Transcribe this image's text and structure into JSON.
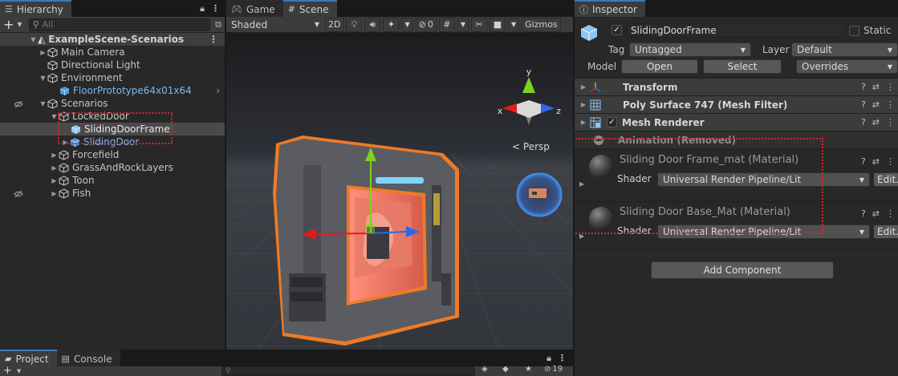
{
  "hierarchy": {
    "tab_label": "Hierarchy",
    "search_placeholder": "All",
    "items": [
      {
        "label": "ExampleScene-Scenarios"
      },
      {
        "label": "Main Camera"
      },
      {
        "label": "Directional Light"
      },
      {
        "label": "Environment"
      },
      {
        "label": "FloorPrototype64x01x64"
      },
      {
        "label": "Scenarios"
      },
      {
        "label": "LockedDoor"
      },
      {
        "label": "SlidingDoorFrame"
      },
      {
        "label": "SlidingDoor"
      },
      {
        "label": "Forcefield"
      },
      {
        "label": "GrassAndRockLayers"
      },
      {
        "label": "Toon"
      },
      {
        "label": "Fish"
      }
    ]
  },
  "scene": {
    "tabs": [
      "Game",
      "Scene"
    ],
    "shading_mode": "Shaded",
    "mode_2d": "2D",
    "hidden_count": "0",
    "gizmos_label": "Gizmos",
    "gizmo_axes": {
      "y": "y",
      "x": "x",
      "z": "z"
    },
    "projection_label": "Persp"
  },
  "inspector": {
    "tab_label": "Inspector",
    "object_name": "SlidingDoorFrame",
    "static_label": "Static",
    "tag_label": "Tag",
    "tag_value": "Untagged",
    "layer_label": "Layer",
    "layer_value": "Default",
    "model_label": "Model",
    "open_button": "Open",
    "select_button": "Select",
    "overrides_label": "Overrides",
    "components": [
      {
        "name": "Transform"
      },
      {
        "name": "Poly Surface 747 (Mesh Filter)"
      },
      {
        "name": "Mesh Renderer"
      },
      {
        "name": "Animation (Removed)"
      }
    ],
    "materials": [
      {
        "title": "Sliding Door Frame_mat (Material)",
        "shader_label": "Shader",
        "shader_value": "Universal Render Pipeline/Lit",
        "edit_label": "Edit..."
      },
      {
        "title": "Sliding Door Base_Mat (Material)",
        "shader_label": "Shader",
        "shader_value": "Universal Render Pipeline/Lit",
        "edit_label": "Edit..."
      }
    ],
    "add_component": "Add Component"
  },
  "bottom": {
    "tabs": [
      "Project",
      "Console"
    ],
    "hidden_count": "19"
  },
  "colors": {
    "selection_outline": "#f07a25",
    "annotation": "#e0202a",
    "prefab_text": "#7cb8f1",
    "accent": "#3a79bb"
  }
}
